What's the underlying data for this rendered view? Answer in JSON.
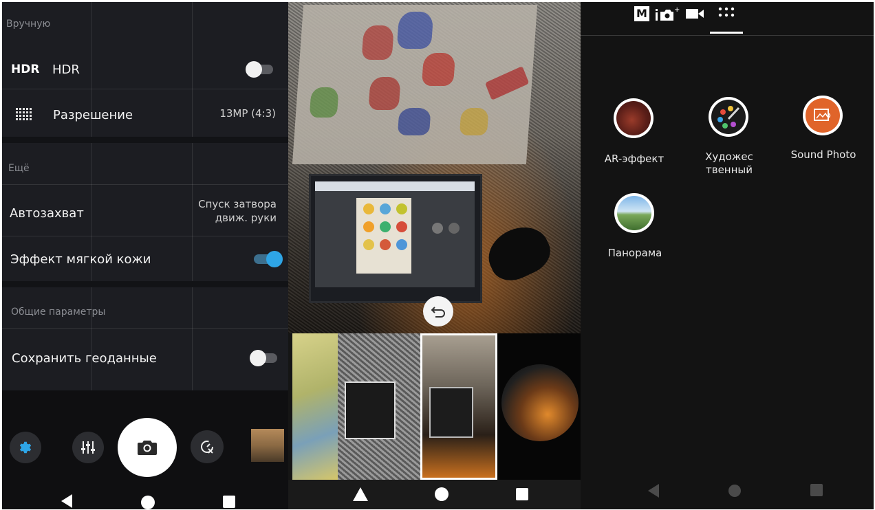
{
  "settings": {
    "section_manual": "Вручную",
    "hdr_badge": "HDR",
    "hdr_label": "HDR",
    "hdr_on": false,
    "resolution_label": "Разрешение",
    "resolution_value": "13MP (4:3)",
    "section_more": "Ещё",
    "autocapture_label": "Автозахват",
    "autocapture_value_line1": "Спуск затвора",
    "autocapture_value_line2": "движ. руки",
    "soft_skin_label": "Эффект мягкой кожи",
    "soft_skin_on": true,
    "section_general": "Общие параметры",
    "geotag_label": "Сохранить геоданные",
    "geotag_on": false
  },
  "camera_controls": {
    "icons": [
      "gear-icon",
      "sliders-icon",
      "camera-icon",
      "self-timer-off-icon",
      "gallery-thumbnail"
    ]
  },
  "nav": {
    "icons": [
      "back-icon",
      "home-icon",
      "recents-icon"
    ]
  },
  "middle": {
    "back_icon": "undo-arrow-icon",
    "filters": [
      "filter-sketch-color",
      "filter-pencil-bw",
      "filter-sketch-warm",
      "filter-fisheye"
    ]
  },
  "modes": {
    "tabs": [
      "M",
      "photo-plus-icon",
      "video-icon",
      "grid-dots-icon"
    ],
    "items": [
      {
        "label": "AR-эффект",
        "icon": "dinosaur-icon"
      },
      {
        "label_line1": "Художес",
        "label_line2": "твенный",
        "icon": "palette-icon"
      },
      {
        "label": "Sound Photo",
        "icon": "sound-photo-icon"
      },
      {
        "label": "Панорама",
        "icon": "panorama-icon"
      }
    ]
  },
  "colors": {
    "accent": "#2ea5e6",
    "panel_bg": "#1c1d22"
  }
}
